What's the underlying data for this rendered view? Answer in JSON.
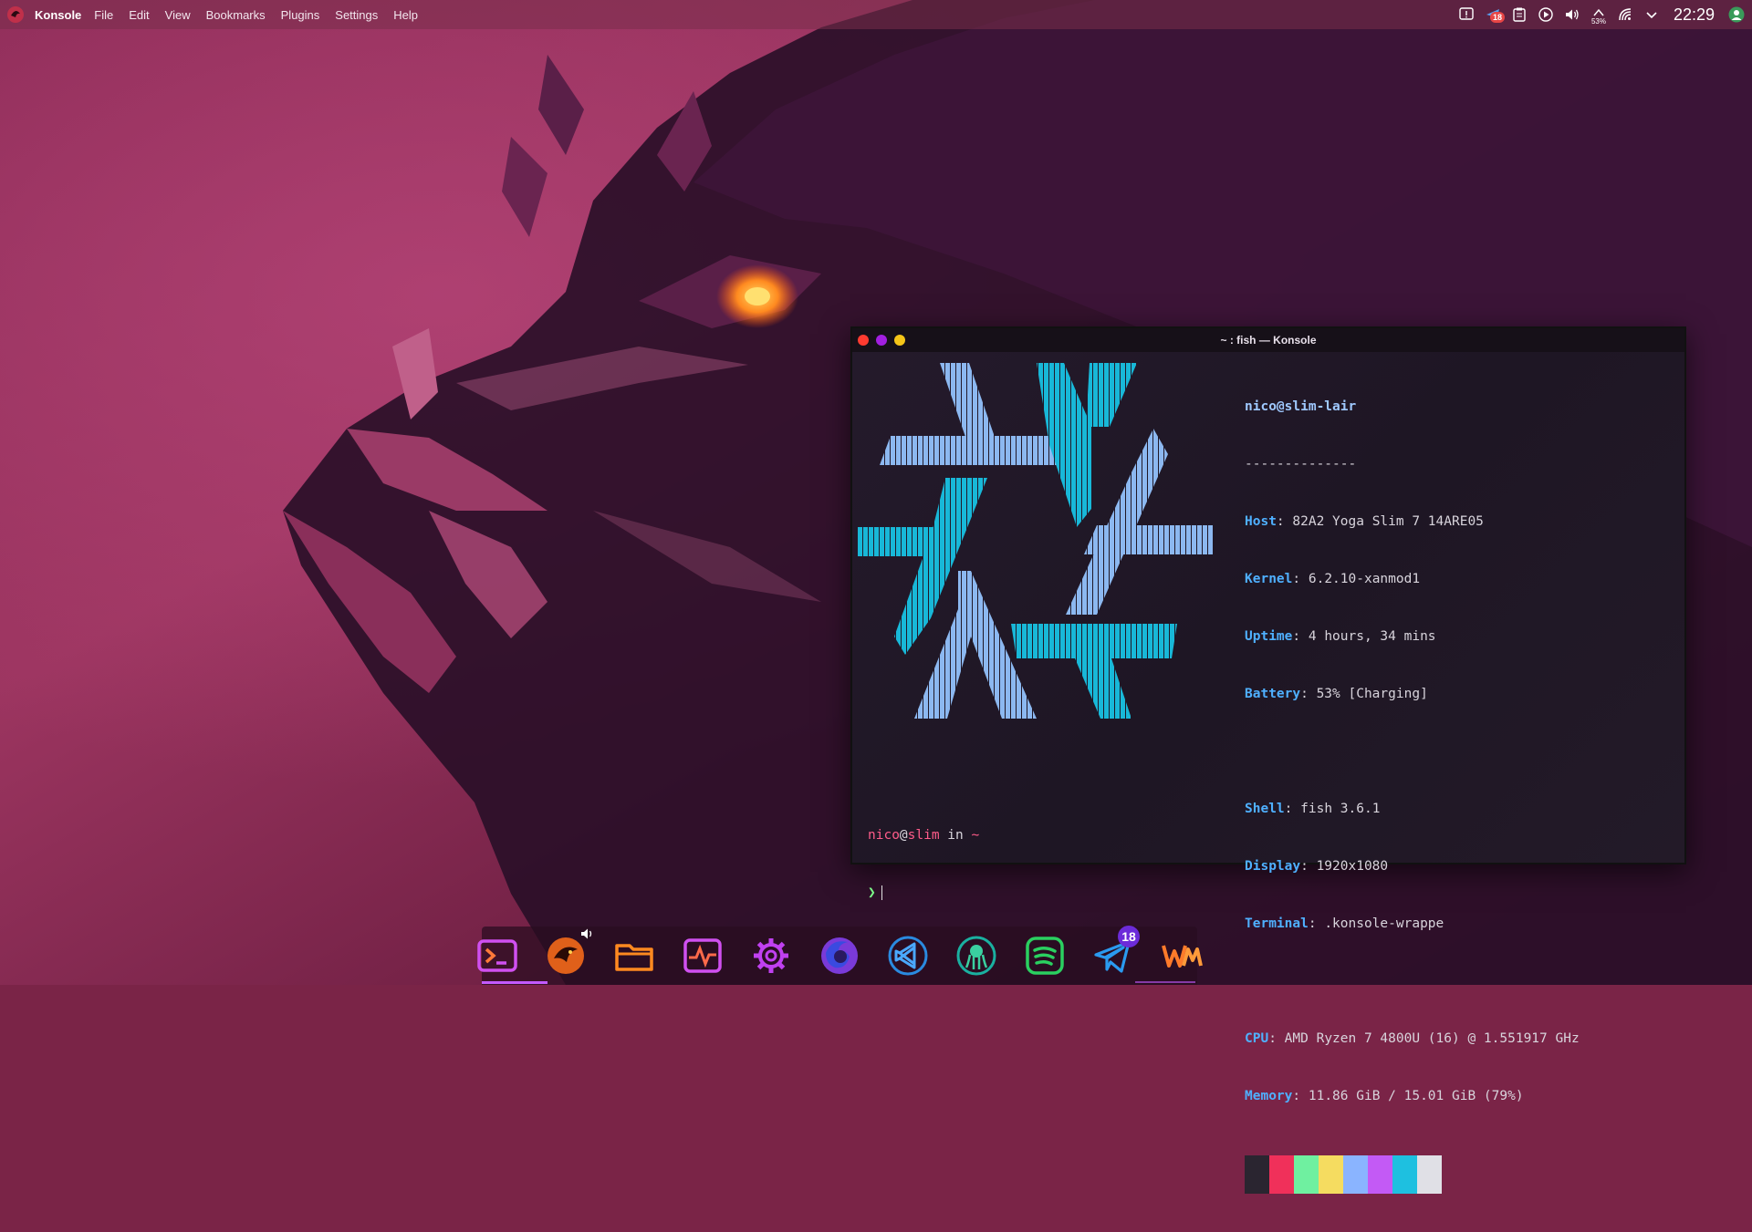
{
  "panel": {
    "app_name": "Konsole",
    "menu": [
      "File",
      "Edit",
      "View",
      "Bookmarks",
      "Plugins",
      "Settings",
      "Help"
    ],
    "tray": {
      "notification_badge": "18",
      "battery_percent": "53%",
      "clock": "22:29"
    }
  },
  "window": {
    "title": "~ : fish — Konsole"
  },
  "neofetch": {
    "user_host": "nico@slim-lair",
    "separator": "--------------",
    "info": [
      {
        "key": "Host",
        "value": "82A2 Yoga Slim 7 14ARE05"
      },
      {
        "key": "Kernel",
        "value": "6.2.10-xanmod1"
      },
      {
        "key": "Uptime",
        "value": "4 hours, 34 mins"
      },
      {
        "key": "Battery",
        "value": "53% [Charging]"
      },
      {
        "key": "Shell",
        "value": "fish 3.6.1"
      },
      {
        "key": "Display",
        "value": "1920x1080"
      },
      {
        "key": "Terminal",
        "value": ".konsole-wrappe"
      },
      {
        "key": "CPU",
        "value": "AMD Ryzen 7 4800U (16) @ 1.551917 GHz"
      },
      {
        "key": "Memory",
        "value": "11.86 GiB / 15.01 GiB (79%)"
      }
    ],
    "palette": [
      "#2a2530",
      "#f0305a",
      "#6ff0a0",
      "#f5dc60",
      "#8ab4ff",
      "#c35af5",
      "#1ec0e0",
      "#e0e0e6"
    ]
  },
  "prompt": {
    "user": "nico",
    "at": "@",
    "host": "slim",
    "in": " in ",
    "dir": "~",
    "arrow": "❯"
  },
  "dock": {
    "items": [
      "terminal",
      "dragon-browser",
      "files",
      "system-monitor",
      "settings",
      "firefox",
      "vscode",
      "gitkraken",
      "spotify",
      "telegram",
      "wm"
    ],
    "telegram_badge": "18"
  },
  "colors": {
    "accent": "#c35aff",
    "logo_light_blue": "#8cb8f0",
    "logo_cyan": "#18b8d8"
  }
}
